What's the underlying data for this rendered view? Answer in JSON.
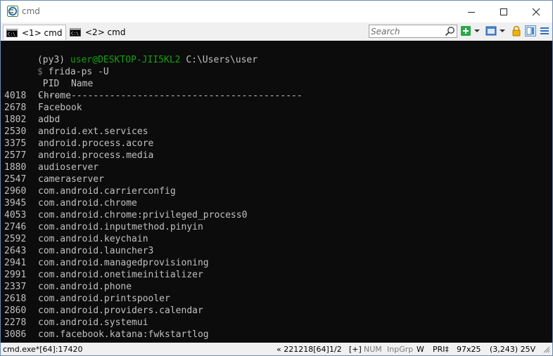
{
  "window": {
    "title": "cmd"
  },
  "tabs": [
    {
      "label": "<1> cmd",
      "active": true
    },
    {
      "label": "<2> cmd",
      "active": false
    }
  ],
  "search": {
    "placeholder": "Search"
  },
  "console": {
    "prompt": {
      "env": "(py3)",
      "user": "user@DESKTOP-JII5KL2",
      "path": "C:\\Users\\user"
    },
    "command": {
      "symbol": "$",
      "text": "frida-ps -U"
    },
    "header": {
      "pid": " PID",
      "name": "Name"
    },
    "separator": {
      "pid": "----",
      "name": "------------------------------------------"
    },
    "processes": [
      {
        "pid": "4018",
        "name": "Chrome"
      },
      {
        "pid": "2678",
        "name": "Facebook"
      },
      {
        "pid": "1802",
        "name": "adbd"
      },
      {
        "pid": "2530",
        "name": "android.ext.services"
      },
      {
        "pid": "3375",
        "name": "android.process.acore"
      },
      {
        "pid": "2577",
        "name": "android.process.media"
      },
      {
        "pid": "1880",
        "name": "audioserver"
      },
      {
        "pid": "2547",
        "name": "cameraserver"
      },
      {
        "pid": "2960",
        "name": "com.android.carrierconfig"
      },
      {
        "pid": "3945",
        "name": "com.android.chrome"
      },
      {
        "pid": "4053",
        "name": "com.android.chrome:privileged_process0"
      },
      {
        "pid": "2746",
        "name": "com.android.inputmethod.pinyin"
      },
      {
        "pid": "2592",
        "name": "com.android.keychain"
      },
      {
        "pid": "2643",
        "name": "com.android.launcher3"
      },
      {
        "pid": "2941",
        "name": "com.android.managedprovisioning"
      },
      {
        "pid": "2991",
        "name": "com.android.onetimeinitializer"
      },
      {
        "pid": "2337",
        "name": "com.android.phone"
      },
      {
        "pid": "2618",
        "name": "com.android.printspooler"
      },
      {
        "pid": "2860",
        "name": "com.android.providers.calendar"
      },
      {
        "pid": "2278",
        "name": "com.android.systemui"
      },
      {
        "pid": "3086",
        "name": "com.facebook.katana:fwkstartlog"
      }
    ]
  },
  "statusbar": {
    "process": "cmd.exe*[64]:17420",
    "server": "« 221218[64]",
    "console_index": "1/2",
    "plus": "[+]",
    "num": "NUM",
    "inpgrp": "InpGrp",
    "w": "W",
    "priority": "PRI‡",
    "size": "97x25",
    "cursor": "(3,243) 25V"
  },
  "colors": {
    "console_bg": "#0c0c0c",
    "console_fg": "#c0c0c0",
    "prompt_green": "#13a10e",
    "chrome": "#f0f0f0"
  },
  "icons": [
    "conemu-app-icon",
    "minimize-icon",
    "maximize-icon",
    "close-icon",
    "cmd-tab-icon",
    "search-icon",
    "new-console-icon",
    "dropdown-icon",
    "window-mode-icon",
    "lock-icon",
    "tile-icon",
    "menu-icon"
  ]
}
